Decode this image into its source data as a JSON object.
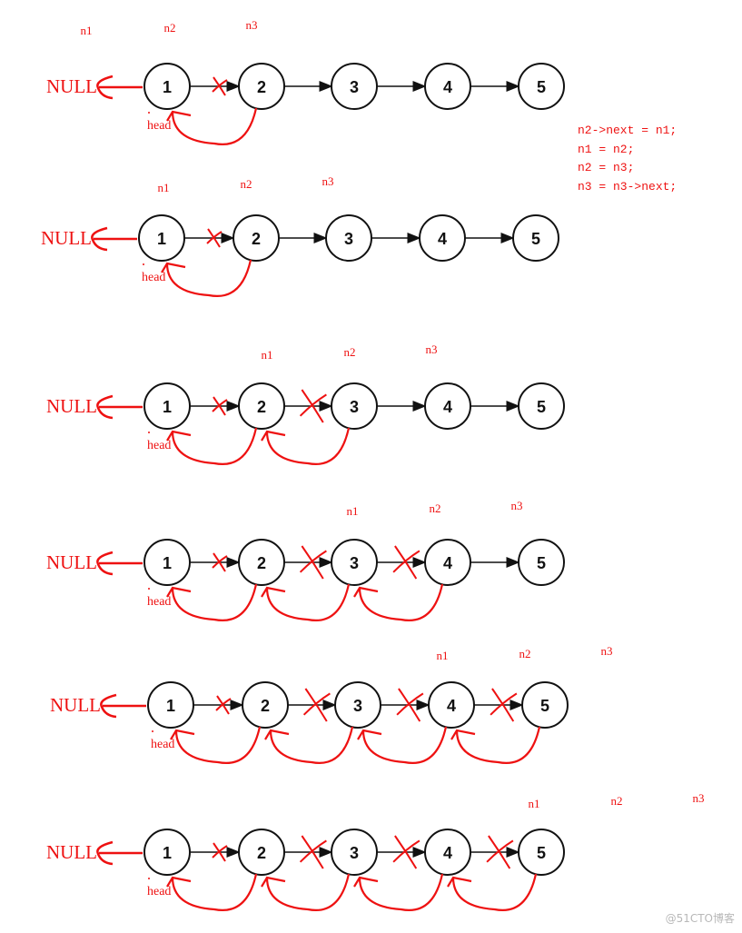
{
  "null_label": "NULL",
  "head_label": "head",
  "node_values": [
    "1",
    "2",
    "3",
    "4",
    "5"
  ],
  "colors": {
    "annotation": "#ee1111",
    "node_stroke": "#111111",
    "watermark": "#b8b8b8"
  },
  "rows": [
    {
      "pointers": [
        "n1",
        "n2",
        "n3"
      ],
      "reversed_links": 1
    },
    {
      "pointers": [
        "n1",
        "n2",
        "n3"
      ],
      "reversed_links": 1
    },
    {
      "pointers": [
        "n1",
        "n2",
        "n3"
      ],
      "reversed_links": 2
    },
    {
      "pointers": [
        "n1",
        "n2",
        "n3"
      ],
      "reversed_links": 3
    },
    {
      "pointers": [
        "n1",
        "n2",
        "n3"
      ],
      "reversed_links": 4
    },
    {
      "pointers": [
        "n1",
        "n2",
        "n3"
      ],
      "reversed_links": 4
    }
  ],
  "code_lines": [
    "n2->next = n1;",
    "n1 = n2;",
    "n2 = n3;",
    "n3 = n3->next;"
  ],
  "watermark": "@51CTO博客"
}
